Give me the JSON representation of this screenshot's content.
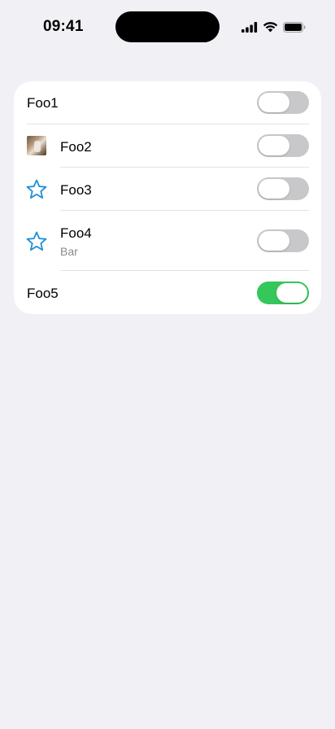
{
  "status_bar": {
    "time": "09:41",
    "icons": [
      "cellular-signal-icon",
      "wifi-icon",
      "battery-icon"
    ]
  },
  "colors": {
    "background": "#f0f0f5",
    "card": "#ffffff",
    "toggle_off": "#c8c8ca",
    "toggle_on": "#34c759",
    "star": "#1d8fd6",
    "subtitle": "#8a8a8e"
  },
  "settings_list": {
    "rows": [
      {
        "label": "Foo1",
        "icon": null,
        "toggle_on": false
      },
      {
        "label": "Foo2",
        "icon": "photo-thumbnail",
        "toggle_on": false
      },
      {
        "label": "Foo3",
        "icon": "star-icon",
        "toggle_on": false
      },
      {
        "label": "Foo4",
        "subtitle": "Bar",
        "icon": "star-icon",
        "toggle_on": false
      },
      {
        "label": "Foo5",
        "icon": null,
        "toggle_on": true
      }
    ]
  }
}
